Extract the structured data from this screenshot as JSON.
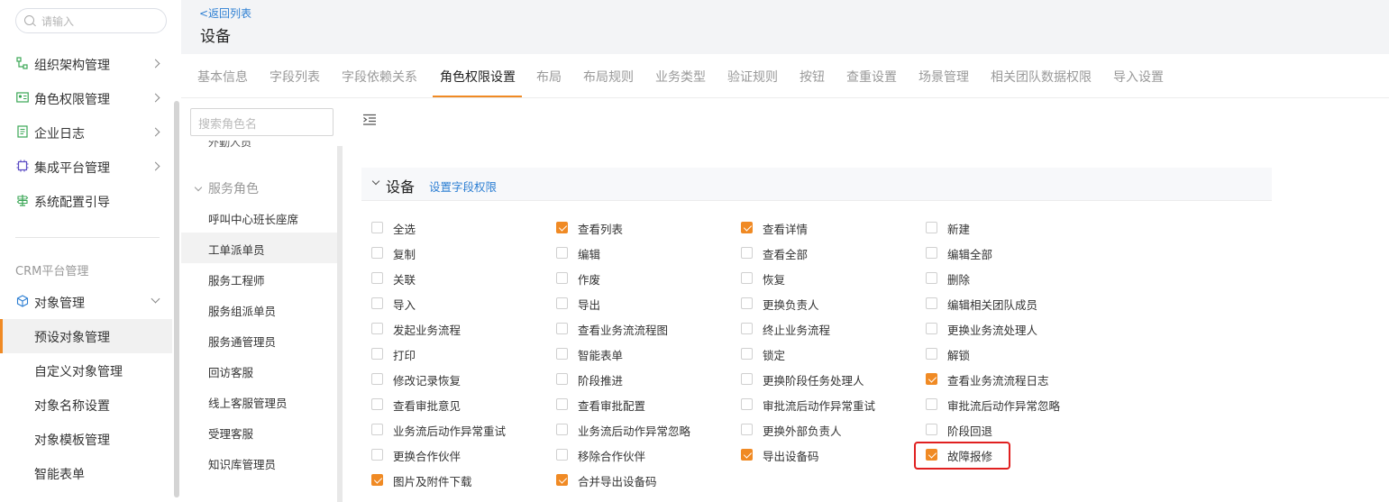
{
  "sidebar": {
    "search_placeholder": "请输入",
    "items": [
      {
        "label": "组织架构管理",
        "icon": "org-tree-icon"
      },
      {
        "label": "角色权限管理",
        "icon": "id-card-icon"
      },
      {
        "label": "企业日志",
        "icon": "log-file-icon"
      },
      {
        "label": "集成平台管理",
        "icon": "chip-icon"
      },
      {
        "label": "系统配置引导",
        "icon": "signpost-icon"
      }
    ],
    "section_label": "CRM平台管理",
    "object_menu": {
      "label": "对象管理",
      "icon": "cube-icon"
    },
    "sub_items": [
      "预设对象管理",
      "自定义对象管理",
      "对象名称设置",
      "对象模板管理",
      "智能表单"
    ]
  },
  "header": {
    "back_link": "<返回列表",
    "title": "设备"
  },
  "tabs": [
    "基本信息",
    "字段列表",
    "字段依赖关系",
    "角色权限设置",
    "布局",
    "布局规则",
    "业务类型",
    "验证规则",
    "按钮",
    "查重设置",
    "场景管理",
    "相关团队数据权限",
    "导入设置"
  ],
  "active_tab": "角色权限设置",
  "roles": {
    "search_placeholder": "搜索角色名",
    "partial_above": "外勤人员",
    "group_label": "服务角色",
    "items": [
      "呼叫中心班长座席",
      "工单派单员",
      "服务工程师",
      "服务组派单员",
      "服务通管理员",
      "回访客服",
      "线上客服管理员",
      "受理客服",
      "知识库管理员"
    ],
    "active_role": "工单派单员"
  },
  "permissions": {
    "object_title": "设备",
    "field_perm_link": "设置字段权限",
    "rows": [
      [
        {
          "label": "全选",
          "checked": false
        },
        {
          "label": "查看列表",
          "checked": true
        },
        {
          "label": "查看详情",
          "checked": true
        },
        {
          "label": "新建",
          "checked": false
        }
      ],
      [
        {
          "label": "复制",
          "checked": false
        },
        {
          "label": "编辑",
          "checked": false
        },
        {
          "label": "查看全部",
          "checked": false
        },
        {
          "label": "编辑全部",
          "checked": false
        }
      ],
      [
        {
          "label": "关联",
          "checked": false
        },
        {
          "label": "作废",
          "checked": false
        },
        {
          "label": "恢复",
          "checked": false
        },
        {
          "label": "删除",
          "checked": false
        }
      ],
      [
        {
          "label": "导入",
          "checked": false
        },
        {
          "label": "导出",
          "checked": false
        },
        {
          "label": "更换负责人",
          "checked": false
        },
        {
          "label": "编辑相关团队成员",
          "checked": false
        }
      ],
      [
        {
          "label": "发起业务流程",
          "checked": false
        },
        {
          "label": "查看业务流流程图",
          "checked": false
        },
        {
          "label": "终止业务流程",
          "checked": false
        },
        {
          "label": "更换业务流处理人",
          "checked": false
        }
      ],
      [
        {
          "label": "打印",
          "checked": false
        },
        {
          "label": "智能表单",
          "checked": false
        },
        {
          "label": "锁定",
          "checked": false
        },
        {
          "label": "解锁",
          "checked": false
        }
      ],
      [
        {
          "label": "修改记录恢复",
          "checked": false
        },
        {
          "label": "阶段推进",
          "checked": false
        },
        {
          "label": "更换阶段任务处理人",
          "checked": false
        },
        {
          "label": "查看业务流流程日志",
          "checked": true
        }
      ],
      [
        {
          "label": "查看审批意见",
          "checked": false
        },
        {
          "label": "查看审批配置",
          "checked": false
        },
        {
          "label": "审批流后动作异常重试",
          "checked": false
        },
        {
          "label": "审批流后动作异常忽略",
          "checked": false
        }
      ],
      [
        {
          "label": "业务流后动作异常重试",
          "checked": false
        },
        {
          "label": "业务流后动作异常忽略",
          "checked": false
        },
        {
          "label": "更换外部负责人",
          "checked": false
        },
        {
          "label": "阶段回退",
          "checked": false
        }
      ],
      [
        {
          "label": "更换合作伙伴",
          "checked": false
        },
        {
          "label": "移除合作伙伴",
          "checked": false
        },
        {
          "label": "导出设备码",
          "checked": true
        },
        {
          "label": "故障报修",
          "checked": true
        }
      ],
      [
        {
          "label": "图片及附件下载",
          "checked": true
        },
        {
          "label": "合并导出设备码",
          "checked": true
        }
      ]
    ]
  },
  "colors": {
    "accent": "#f08a24",
    "link": "#2d7fd3",
    "highlight": "#e02020"
  }
}
